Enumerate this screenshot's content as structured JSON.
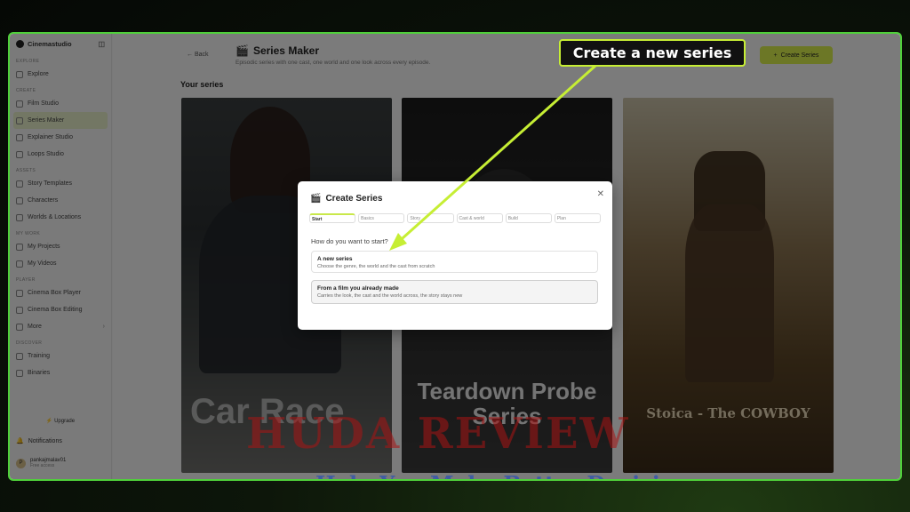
{
  "app": {
    "brand": "Cinemastudio"
  },
  "sidebar": {
    "sections": [
      {
        "label": "EXPLORE",
        "items": [
          {
            "label": "Explore"
          }
        ]
      },
      {
        "label": "CREATE",
        "items": [
          {
            "label": "Film Studio"
          },
          {
            "label": "Series Maker"
          },
          {
            "label": "Explainer Studio"
          },
          {
            "label": "Loops Studio"
          }
        ]
      },
      {
        "label": "ASSETS",
        "items": [
          {
            "label": "Story Templates"
          },
          {
            "label": "Characters"
          },
          {
            "label": "Worlds & Locations"
          }
        ]
      },
      {
        "label": "MY WORK",
        "items": [
          {
            "label": "My Projects"
          },
          {
            "label": "My Videos"
          }
        ]
      },
      {
        "label": "PLAYER",
        "items": [
          {
            "label": "Cinema Box Player"
          },
          {
            "label": "Cinema Box Editing"
          },
          {
            "label": "More"
          }
        ]
      },
      {
        "label": "DISCOVER",
        "items": [
          {
            "label": "Training"
          },
          {
            "label": "Binaries"
          }
        ]
      }
    ],
    "upgrade": "Upgrade",
    "notifications": "Notifications",
    "user": {
      "name": "pankajmalav01",
      "plan": "Free access",
      "initial": "P"
    }
  },
  "header": {
    "back": "Back",
    "title": "Series Maker",
    "subtitle": "Episodic series with one cast, one world and one look across every episode.",
    "create_button": "Create Series"
  },
  "main": {
    "section_title": "Your series",
    "cards": [
      {
        "title": "Car Race"
      },
      {
        "title": "Teardown Probe Series"
      },
      {
        "title": "Stoica - The COWBOY"
      }
    ]
  },
  "modal": {
    "title": "Create Series",
    "steps": [
      "Start",
      "Basics",
      "Story",
      "Cast & world",
      "Build",
      "Plan"
    ],
    "question": "How do you want to start?",
    "options": [
      {
        "title": "A new series",
        "desc": "Choose the genre, the world and the cast from scratch"
      },
      {
        "title": "From a film you already made",
        "desc": "Carries the look, the cast and the world across, the story stays new"
      }
    ]
  },
  "watermark": {
    "big": "HUDA REVIEW",
    "small": "Help You Make Better Decisions"
  },
  "callout": {
    "text": "Create a new series"
  },
  "colors": {
    "accent": "#c6ee34",
    "frame": "#4fd13a"
  }
}
